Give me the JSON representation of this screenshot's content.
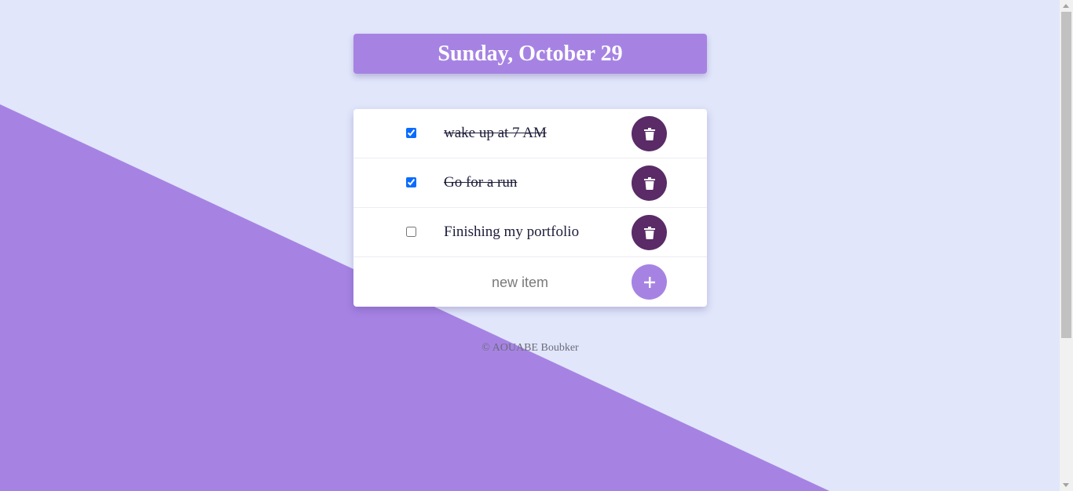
{
  "header": {
    "date": "Sunday, October 29"
  },
  "todos": [
    {
      "text": "wake up at 7 AM",
      "checked": true
    },
    {
      "text": "Go for a run",
      "checked": true
    },
    {
      "text": "Finishing my portfolio",
      "checked": false
    }
  ],
  "new_item": {
    "placeholder": "new item",
    "add_label": "+"
  },
  "footer": {
    "text": "© AOUABE Boubker"
  },
  "colors": {
    "background": "#e1e6fb",
    "accent": "#a683e3",
    "delete_button": "#5a2b67",
    "checkbox": "#0a6cff"
  },
  "icons": {
    "delete": "trash-icon",
    "add": "plus-icon"
  }
}
